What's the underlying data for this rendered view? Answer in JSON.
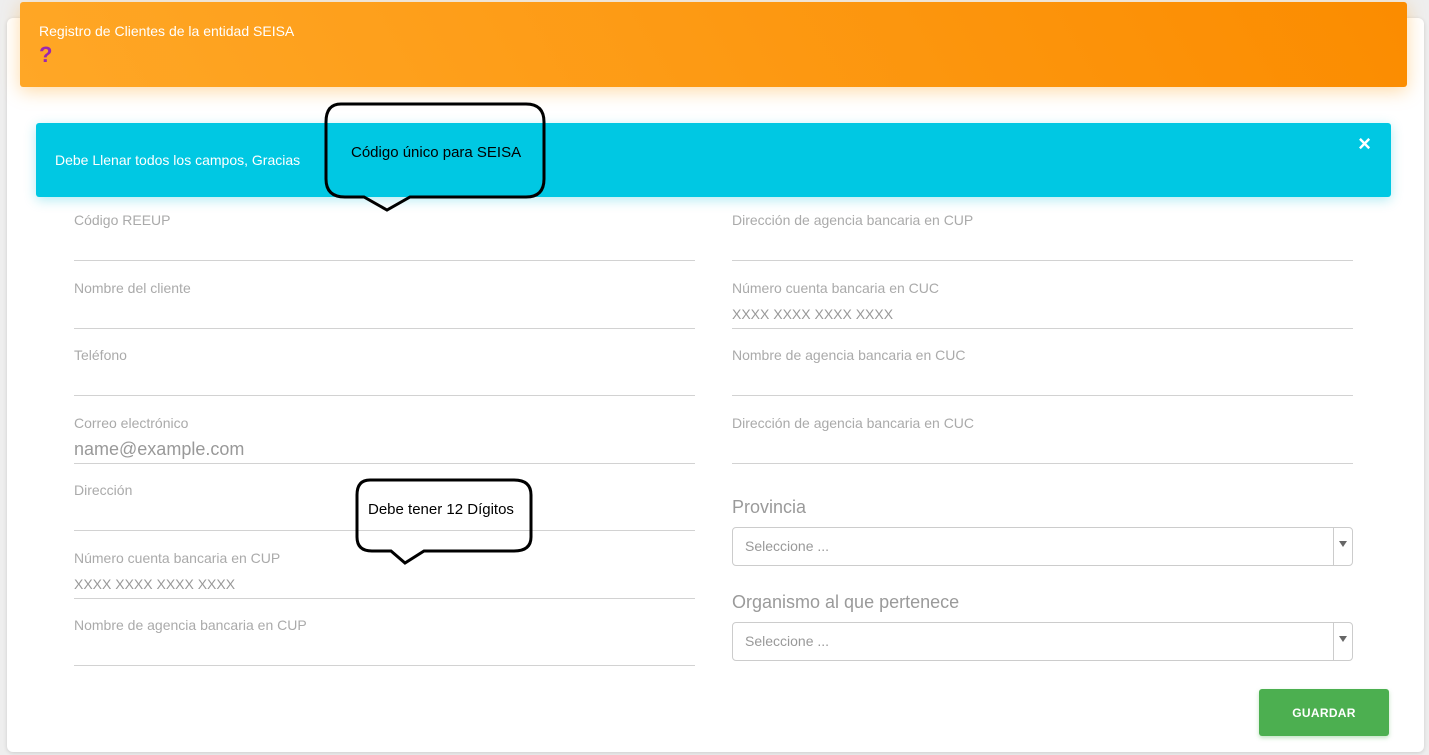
{
  "header": {
    "title": "Registro de Clientes de la entidad SEISA",
    "help_icon": "question-mark-icon",
    "help_glyph": "?"
  },
  "alert": {
    "message": "Debe Llenar todos los campos, Gracias",
    "close_glyph": "×"
  },
  "form": {
    "left": [
      {
        "label": "Código REEUP",
        "placeholder": ""
      },
      {
        "label": "Nombre del cliente",
        "placeholder": ""
      },
      {
        "label": "Teléfono",
        "placeholder": ""
      },
      {
        "label": "Correo electrónico",
        "placeholder": "name@example.com"
      },
      {
        "label": "Dirección",
        "placeholder": ""
      },
      {
        "label": "Número cuenta bancaria en CUP",
        "placeholder": "XXXX XXXX XXXX XXXX"
      },
      {
        "label": "Nombre de agencia bancaria en CUP",
        "placeholder": ""
      }
    ],
    "right": [
      {
        "label": "Dirección de agencia bancaria en CUP",
        "placeholder": ""
      },
      {
        "label": "Número cuenta bancaria en CUC",
        "placeholder": "XXXX XXXX XXXX XXXX"
      },
      {
        "label": "Nombre de agencia bancaria en CUC",
        "placeholder": ""
      },
      {
        "label": "Dirección de agencia bancaria en CUC",
        "placeholder": ""
      }
    ],
    "provincia": {
      "label": "Provincia",
      "value": "Seleccione ..."
    },
    "organismo": {
      "label": "Organismo al que pertenece",
      "value": "Seleccione ..."
    },
    "save_label": "GUARDAR"
  },
  "callouts": {
    "codigo": "Código único para SEISA",
    "digitos": "Debe tener 12 Dígitos"
  },
  "colors": {
    "header_start": "#ffa726",
    "header_end": "#fb8c00",
    "alert": "#00c8e3",
    "help_icon": "#9c27b0",
    "save_button": "#4caf50"
  }
}
